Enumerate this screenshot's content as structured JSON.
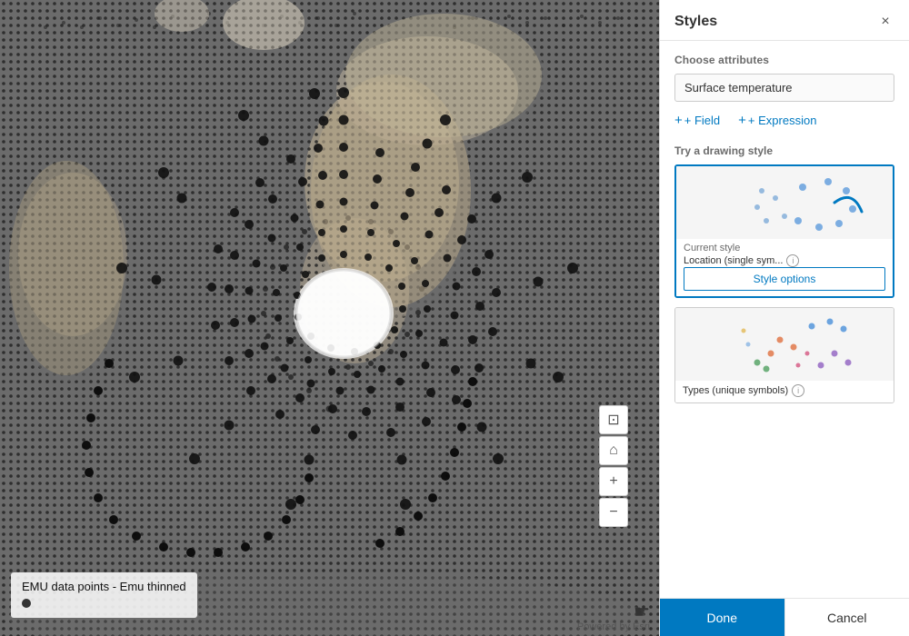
{
  "panel": {
    "title": "Styles",
    "close_label": "×",
    "choose_attributes_label": "Choose attributes",
    "attribute_value": "Surface temperature",
    "field_btn": "+ Field",
    "expression_btn": "+ Expression",
    "drawing_style_label": "Try a drawing style",
    "current_style_label": "Current style",
    "current_style_name": "Location (single sym...",
    "style_options_btn": "Style options",
    "types_label": "Types (unique symbols)",
    "done_btn": "Done",
    "cancel_btn": "Cancel"
  },
  "map": {
    "legend_title": "EMU data points - Emu thinned",
    "powered_by": "Powered by Esri"
  },
  "tools": {
    "screen_icon": "⊡",
    "home_icon": "⌂",
    "zoom_in": "+",
    "zoom_out": "−"
  }
}
